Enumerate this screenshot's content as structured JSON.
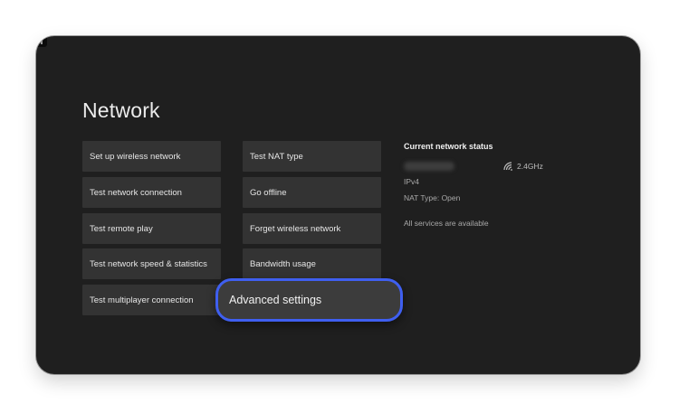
{
  "page": {
    "title": "Network"
  },
  "left_column": [
    {
      "label": "Set up wireless network"
    },
    {
      "label": "Test network connection"
    },
    {
      "label": "Test remote play"
    },
    {
      "label": "Test network speed & statistics"
    },
    {
      "label": "Test multiplayer connection"
    }
  ],
  "middle_column": [
    {
      "label": "Test NAT type"
    },
    {
      "label": "Go offline"
    },
    {
      "label": "Forget wireless network"
    },
    {
      "label": "Bandwidth usage"
    }
  ],
  "focused_tile": {
    "label": "Advanced settings",
    "focus_color": "#3f5ff0"
  },
  "status": {
    "title": "Current network status",
    "network_name_redacted": true,
    "band_icon": "wifi-signal-icon",
    "band": "2.4GHz",
    "ip_version": "IPv4",
    "nat_type": "NAT Type: Open",
    "services": "All services are available"
  },
  "colors": {
    "background": "#1f1f1f",
    "tile": "#333333",
    "accent": "#3f5ff0"
  }
}
